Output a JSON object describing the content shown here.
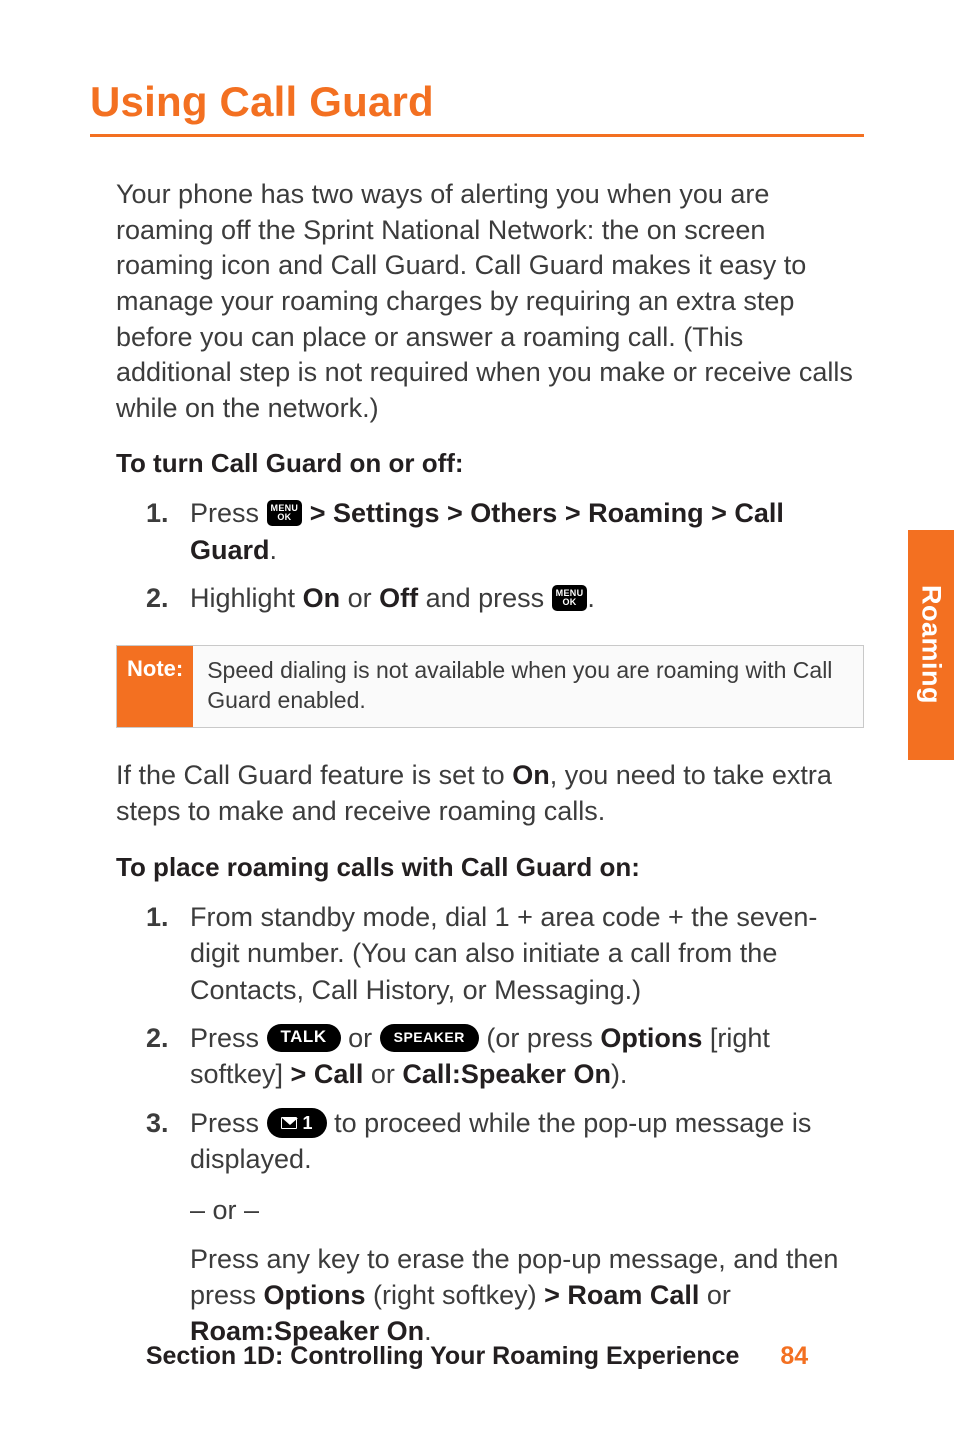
{
  "title": "Using Call Guard",
  "intro": "Your phone has two ways of alerting you when you are roaming off the Sprint National Network: the on screen roaming icon and Call Guard. Call Guard makes it easy to manage your roaming charges by requiring an extra step before you can place or answer a roaming call. (This additional step is not required when you make or receive calls while on the network.)",
  "sub1_heading": "To turn Call Guard on or off:",
  "sub1_steps": {
    "s1": {
      "num": "1.",
      "pre": "Press ",
      "path": " > Settings > Others > Roaming > Call Guard",
      "end": "."
    },
    "s2": {
      "num": "2.",
      "pre": "Highlight ",
      "on": "On",
      "mid": " or ",
      "off": "Off",
      "post": " and press ",
      "end": "."
    }
  },
  "note": {
    "label": "Note:",
    "text": "Speed dialing is not available when you are roaming with Call Guard enabled."
  },
  "after_note": {
    "pre": "If the Call Guard feature is set to ",
    "on": "On",
    "post": ", you need to take extra steps to make and receive roaming calls."
  },
  "sub2_heading": "To place roaming calls with Call Guard on:",
  "sub2_steps": {
    "s1": {
      "num": "1.",
      "text": "From standby mode, dial 1 + area code + the seven-digit number. (You can also initiate a call from the Contacts, Call History, or Messaging.)"
    },
    "s2": {
      "num": "2.",
      "pre": "Press ",
      "talk": "TALK",
      "mid1": " or ",
      "speaker": "SPEAKER",
      "mid2": " (or press ",
      "options": "Options",
      "mid3": " [right softkey] ",
      "call": "> Call",
      "mid4": " or ",
      "callsp": "Call:Speaker On",
      "end": ")."
    },
    "s3": {
      "num": "3.",
      "pre": "Press ",
      "one": "1",
      "post": " to proceed while the pop-up message is displayed.",
      "or": "– or –",
      "alt_pre": "Press any key to erase the pop-up message, and then press ",
      "options": "Options",
      "alt_mid1": " (right softkey) ",
      "roamcall": "> Roam Call",
      "alt_mid2": " or ",
      "roamsp": "Roam:Speaker On",
      "alt_end": "."
    }
  },
  "keys": {
    "menu_top": "MENU",
    "menu_bot": "OK"
  },
  "side_tab": "Roaming",
  "footer": {
    "section": "Section 1D: Controlling Your Roaming Experience",
    "page": "84"
  }
}
